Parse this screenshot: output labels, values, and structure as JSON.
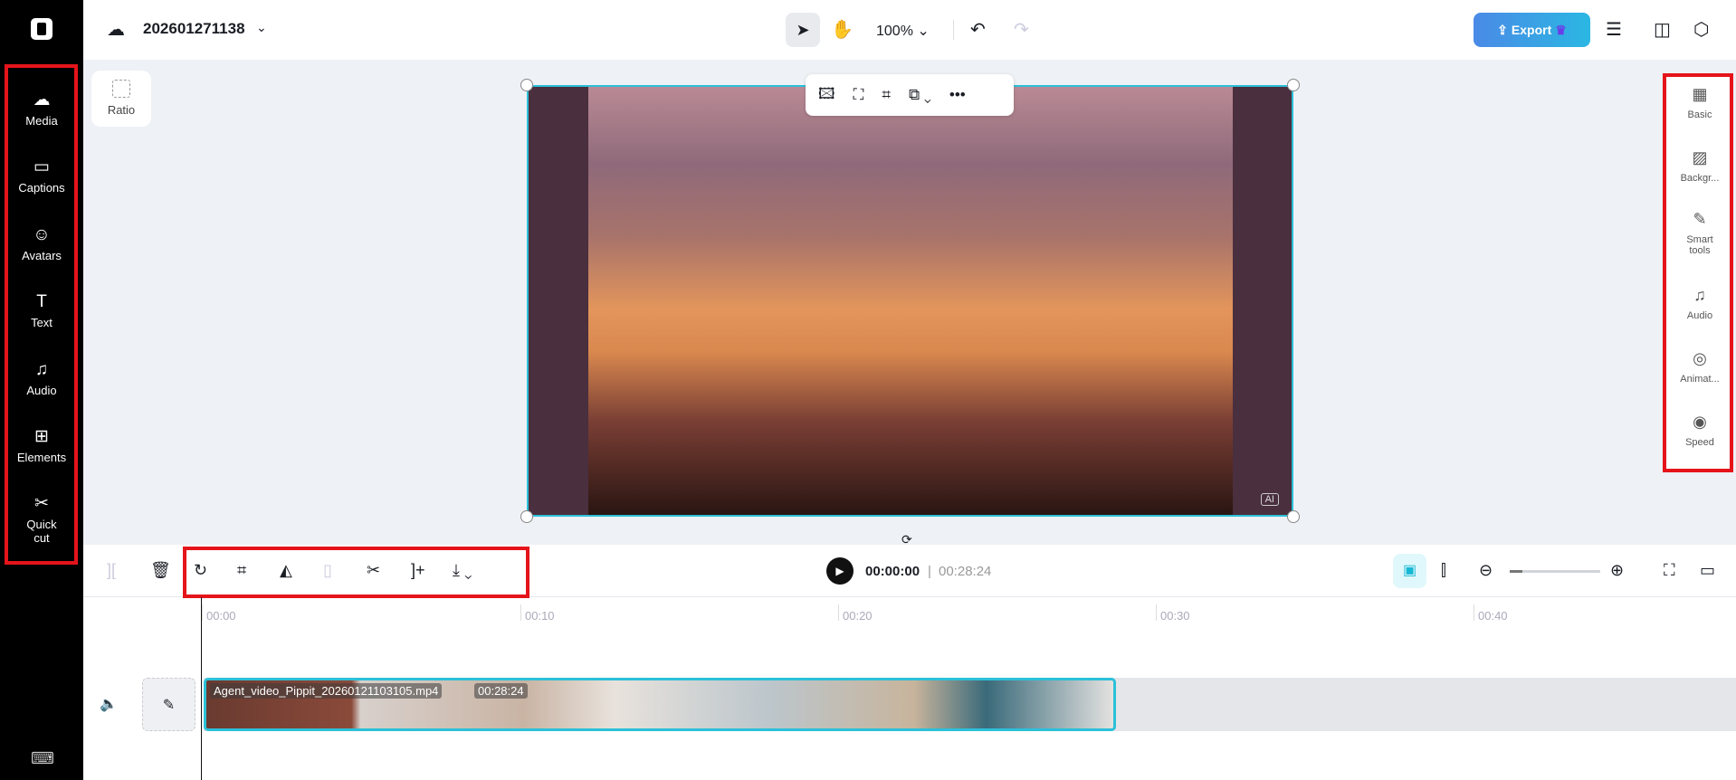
{
  "header": {
    "project_name": "202601271138",
    "zoom": "100%",
    "export_label": "Export"
  },
  "left_nav": [
    {
      "label": "Media",
      "icon": "cloud-upload-icon"
    },
    {
      "label": "Captions",
      "icon": "captions-icon"
    },
    {
      "label": "Avatars",
      "icon": "avatar-icon"
    },
    {
      "label": "Text",
      "icon": "text-icon"
    },
    {
      "label": "Audio",
      "icon": "music-icon"
    },
    {
      "label": "Elements",
      "icon": "elements-icon"
    },
    {
      "label": "Quick cut",
      "icon": "quick-cut-icon"
    }
  ],
  "canvas": {
    "ratio_label": "Ratio",
    "ai_badge": "AI"
  },
  "right_panel": [
    {
      "label": "Basic"
    },
    {
      "label": "Backgr..."
    },
    {
      "label": "Smart tools"
    },
    {
      "label": "Audio"
    },
    {
      "label": "Animat..."
    },
    {
      "label": "Speed"
    }
  ],
  "playback": {
    "current": "00:00:00",
    "separator": "|",
    "total": "00:28:24"
  },
  "ruler": [
    "00:00",
    "00:10",
    "00:20",
    "00:30",
    "00:40"
  ],
  "clip": {
    "name": "Agent_video_Pippit_20260121103105.mp4",
    "duration": "00:28:24"
  },
  "colors": {
    "accent": "#2bc0d8",
    "highlight": "#e5141b"
  }
}
